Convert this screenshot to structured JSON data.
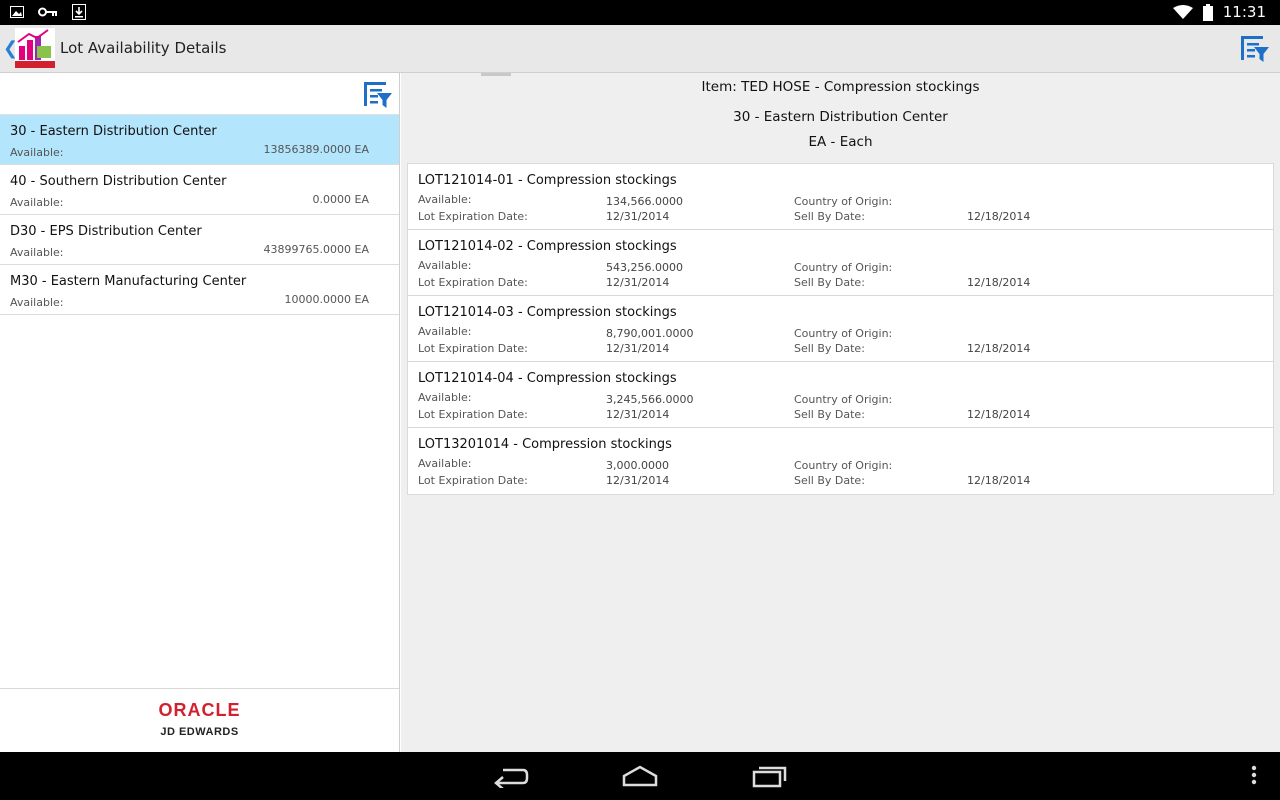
{
  "status_bar": {
    "time": "11:31"
  },
  "action_bar": {
    "title": "Lot Availability Details",
    "back_glyph": "❮"
  },
  "locations": [
    {
      "name": "30 - Eastern Distribution Center",
      "available_label": "Available:",
      "available_value": "13856389.0000 EA",
      "selected": true
    },
    {
      "name": "40 - Southern Distribution Center",
      "available_label": "Available:",
      "available_value": "0.0000 EA",
      "selected": false
    },
    {
      "name": "D30 - EPS Distribution Center",
      "available_label": "Available:",
      "available_value": "43899765.0000 EA",
      "selected": false
    },
    {
      "name": "M30 - Eastern Manufacturing Center",
      "available_label": "Available:",
      "available_value": "10000.0000 EA",
      "selected": false
    }
  ],
  "footer": {
    "oracle": "ORACLE",
    "jde": "JD EDWARDS"
  },
  "detail": {
    "item": "Item: TED HOSE - Compression stockings",
    "location": "30 - Eastern Distribution Center",
    "uom": "EA - Each",
    "labels": {
      "available": "Available:",
      "lot_expiration": "Lot Expiration Date:",
      "country": "Country of Origin:",
      "sell_by": "Sell By Date:"
    },
    "lots": [
      {
        "title": "LOT121014-01 - Compression stockings",
        "available": "134,566.0000",
        "lot_expiration": "12/31/2014",
        "country": "",
        "sell_by": "12/18/2014"
      },
      {
        "title": "LOT121014-02 - Compression stockings",
        "available": "543,256.0000",
        "lot_expiration": "12/31/2014",
        "country": "",
        "sell_by": "12/18/2014"
      },
      {
        "title": "LOT121014-03 - Compression stockings",
        "available": "8,790,001.0000",
        "lot_expiration": "12/31/2014",
        "country": "",
        "sell_by": "12/18/2014"
      },
      {
        "title": "LOT121014-04 - Compression stockings",
        "available": "3,245,566.0000",
        "lot_expiration": "12/31/2014",
        "country": "",
        "sell_by": "12/18/2014"
      },
      {
        "title": "LOT13201014 - Compression stockings",
        "available": "3,000.0000",
        "lot_expiration": "12/31/2014",
        "country": "",
        "sell_by": "12/18/2014"
      }
    ]
  },
  "colors": {
    "accent": "#2a7fd4",
    "selected_row": "#b3e5fc",
    "oracle_red": "#d2202f"
  }
}
